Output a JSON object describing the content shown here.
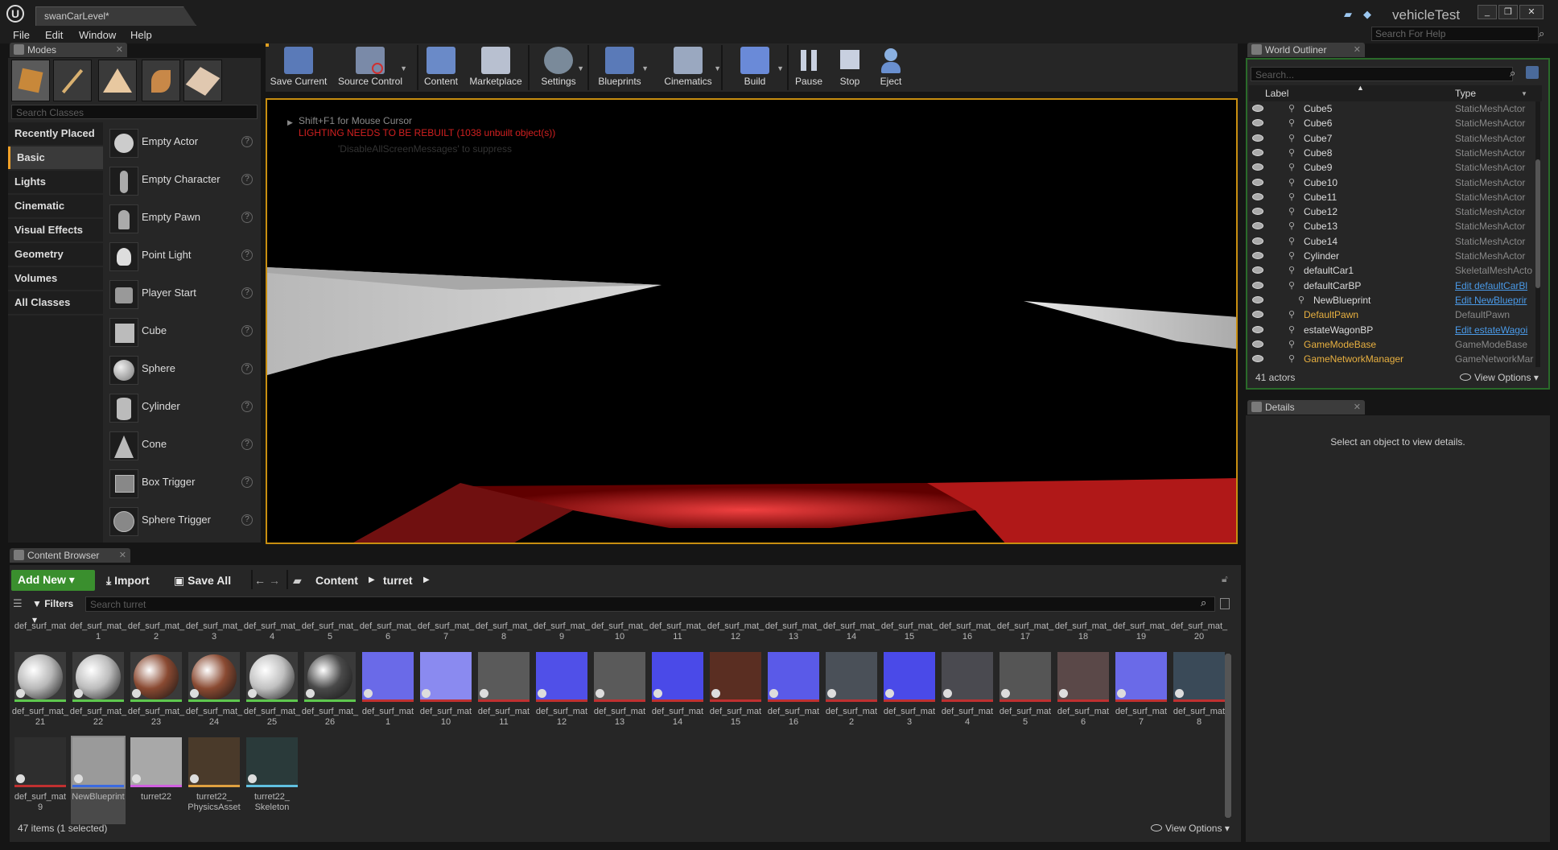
{
  "window": {
    "level_tab": "swanCarLevel*",
    "project_name": "vehicleTest",
    "minimize": "_",
    "restore": "❐",
    "close": "✕"
  },
  "menu": [
    "File",
    "Edit",
    "Window",
    "Help"
  ],
  "help_search": {
    "placeholder": "Search For Help"
  },
  "modes": {
    "tab_title": "Modes",
    "search_placeholder": "Search Classes",
    "categories": [
      "Recently Placed",
      "Basic",
      "Lights",
      "Cinematic",
      "Visual Effects",
      "Geometry",
      "Volumes",
      "All Classes"
    ],
    "active_category": "Basic",
    "items": [
      "Empty Actor",
      "Empty Character",
      "Empty Pawn",
      "Point Light",
      "Player Start",
      "Cube",
      "Sphere",
      "Cylinder",
      "Cone",
      "Box Trigger",
      "Sphere Trigger"
    ]
  },
  "toolbar": {
    "buttons": [
      "Save Current",
      "Source Control",
      "Content",
      "Marketplace",
      "Settings",
      "Blueprints",
      "Cinematics",
      "Build",
      "Pause",
      "Stop",
      "Eject"
    ]
  },
  "viewport": {
    "hint": "Shift+F1 for Mouse Cursor",
    "warning": "LIGHTING NEEDS TO BE REBUILT (1038 unbuilt object(s))",
    "message": "'DisableAllScreenMessages' to suppress"
  },
  "outliner": {
    "tab_title": "World Outliner",
    "search_placeholder": "Search...",
    "col_label": "Label",
    "col_type": "Type",
    "rows": [
      {
        "label": "Cube5",
        "type": "StaticMeshActor",
        "gold": false,
        "link": false
      },
      {
        "label": "Cube6",
        "type": "StaticMeshActor",
        "gold": false,
        "link": false
      },
      {
        "label": "Cube7",
        "type": "StaticMeshActor",
        "gold": false,
        "link": false
      },
      {
        "label": "Cube8",
        "type": "StaticMeshActor",
        "gold": false,
        "link": false
      },
      {
        "label": "Cube9",
        "type": "StaticMeshActor",
        "gold": false,
        "link": false
      },
      {
        "label": "Cube10",
        "type": "StaticMeshActor",
        "gold": false,
        "link": false
      },
      {
        "label": "Cube11",
        "type": "StaticMeshActor",
        "gold": false,
        "link": false
      },
      {
        "label": "Cube12",
        "type": "StaticMeshActor",
        "gold": false,
        "link": false
      },
      {
        "label": "Cube13",
        "type": "StaticMeshActor",
        "gold": false,
        "link": false
      },
      {
        "label": "Cube14",
        "type": "StaticMeshActor",
        "gold": false,
        "link": false
      },
      {
        "label": "Cylinder",
        "type": "StaticMeshActor",
        "gold": false,
        "link": false
      },
      {
        "label": "defaultCar1",
        "type": "SkeletalMeshActo",
        "gold": false,
        "link": false
      },
      {
        "label": "defaultCarBP",
        "type": "Edit defaultCarBl",
        "gold": false,
        "link": true
      },
      {
        "label": "NewBlueprint",
        "type": "Edit NewBlueprir",
        "gold": false,
        "link": true
      },
      {
        "label": "DefaultPawn",
        "type": "DefaultPawn",
        "gold": true,
        "link": false
      },
      {
        "label": "estateWagonBP",
        "type": "Edit estateWagoi",
        "gold": false,
        "link": true
      },
      {
        "label": "GameModeBase",
        "type": "GameModeBase",
        "gold": true,
        "link": false
      },
      {
        "label": "GameNetworkManager",
        "type": "GameNetworkMar",
        "gold": true,
        "link": false
      }
    ],
    "actor_count": "41 actors",
    "view_options": "View Options"
  },
  "details": {
    "tab_title": "Details",
    "empty_message": "Select an object to view details."
  },
  "content_browser": {
    "tab_title": "Content Browser",
    "add_new": "Add New",
    "import": "Import",
    "save_all": "Save All",
    "path": [
      "Content",
      "turret"
    ],
    "filters": "Filters",
    "search_placeholder": "Search turret",
    "top_labels": [
      "def_surf_mat",
      "def_surf_mat_ 1",
      "def_surf_mat_ 2",
      "def_surf_mat_ 3",
      "def_surf_mat_ 4",
      "def_surf_mat_ 5",
      "def_surf_mat_ 6",
      "def_surf_mat_ 7",
      "def_surf_mat_ 8",
      "def_surf_mat_ 9",
      "def_surf_mat_ 10",
      "def_surf_mat_ 11",
      "def_surf_mat_ 12",
      "def_surf_mat_ 13",
      "def_surf_mat_ 14",
      "def_surf_mat_ 15",
      "def_surf_mat_ 16",
      "def_surf_mat_ 17",
      "def_surf_mat_ 18",
      "def_surf_mat_ 19",
      "def_surf_mat_ 20"
    ],
    "row1": [
      {
        "line1": "def_surf_mat_",
        "line2": "21",
        "kind": "mat",
        "color": "#b8b8b8"
      },
      {
        "line1": "def_surf_mat_",
        "line2": "22",
        "kind": "mat",
        "color": "#bcbcbc"
      },
      {
        "line1": "def_surf_mat_",
        "line2": "23",
        "kind": "mat",
        "color": "#8a4a32"
      },
      {
        "line1": "def_surf_mat_",
        "line2": "24",
        "kind": "mat",
        "color": "#8a4a32"
      },
      {
        "line1": "def_surf_mat_",
        "line2": "25",
        "kind": "mat",
        "color": "#c0c0c0"
      },
      {
        "line1": "def_surf_mat_",
        "line2": "26",
        "kind": "mat",
        "color": "#4a4a4a"
      },
      {
        "line1": "def_surf_mat",
        "line2": "1",
        "kind": "tex",
        "color": "#6a6ae8"
      },
      {
        "line1": "def_surf_mat",
        "line2": "10",
        "kind": "tex",
        "color": "#8a8af0"
      },
      {
        "line1": "def_surf_mat",
        "line2": "11",
        "kind": "tex",
        "color": "#5a5a5a"
      },
      {
        "line1": "def_surf_mat",
        "line2": "12",
        "kind": "tex",
        "color": "#5050e8"
      },
      {
        "line1": "def_surf_mat",
        "line2": "13",
        "kind": "tex",
        "color": "#5a5a5a"
      },
      {
        "line1": "def_surf_mat",
        "line2": "14",
        "kind": "tex",
        "color": "#4a4ae8"
      },
      {
        "line1": "def_surf_mat",
        "line2": "15",
        "kind": "tex",
        "color": "#5a2e22"
      },
      {
        "line1": "def_surf_mat",
        "line2": "16",
        "kind": "tex",
        "color": "#5a5ae8"
      },
      {
        "line1": "def_surf_mat",
        "line2": "2",
        "kind": "tex",
        "color": "#4a5058"
      },
      {
        "line1": "def_surf_mat",
        "line2": "3",
        "kind": "tex",
        "color": "#4a4ae8"
      },
      {
        "line1": "def_surf_mat",
        "line2": "4",
        "kind": "tex",
        "color": "#4a4a50"
      },
      {
        "line1": "def_surf_mat",
        "line2": "5",
        "kind": "tex",
        "color": "#555555"
      },
      {
        "line1": "def_surf_mat",
        "line2": "6",
        "kind": "tex",
        "color": "#5a4848"
      },
      {
        "line1": "def_surf_mat",
        "line2": "7",
        "kind": "tex",
        "color": "#6a6ae8"
      },
      {
        "line1": "def_surf_mat",
        "line2": "8",
        "kind": "tex",
        "color": "#3a4a58"
      }
    ],
    "row2": [
      {
        "line1": "def_surf_mat",
        "line2": "9",
        "kind": "tex",
        "color": "#2e2e2e"
      },
      {
        "line1": "NewBlueprint",
        "line2": "",
        "kind": "bp",
        "color": "#9a9a9a"
      },
      {
        "line1": "turret22",
        "line2": "",
        "kind": "mesh",
        "color": "#a8a8a8"
      },
      {
        "line1": "turret22_",
        "line2": "PhysicsAsset",
        "kind": "phys",
        "color": "#4a3a2a"
      },
      {
        "line1": "turret22_",
        "line2": "Skeleton",
        "kind": "skel",
        "color": "#2a3a3a"
      }
    ],
    "item_count": "47 items (1 selected)",
    "view_options": "View Options"
  }
}
